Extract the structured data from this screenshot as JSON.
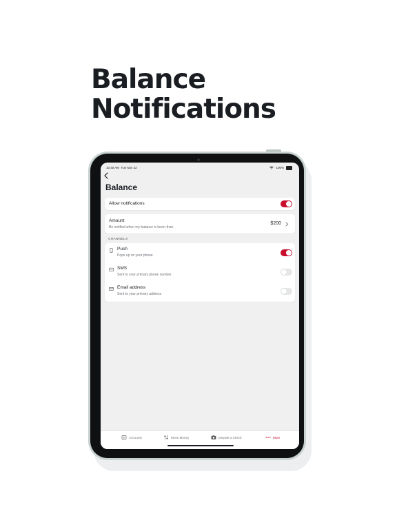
{
  "headline": {
    "line1": "Balance",
    "line2": "Notifications"
  },
  "status_bar": {
    "time": "10:40 AM",
    "date": "Tue Nov 22",
    "battery": "100%"
  },
  "page": {
    "title": "Balance"
  },
  "allow_notifications": {
    "label": "Allow notifications",
    "enabled": true
  },
  "amount": {
    "title": "Amount",
    "subtitle": "Be notified when my balance is lower than",
    "value": "$200"
  },
  "channels": {
    "section_label": "CHANNELS",
    "items": [
      {
        "name": "Push",
        "description": "Pops up on your phone",
        "icon": "phone-icon",
        "enabled": true
      },
      {
        "name": "SMS",
        "description": "Sent to your primary phone number",
        "icon": "message-icon",
        "enabled": false
      },
      {
        "name": "Email address",
        "description": "Sent to your primary address",
        "icon": "envelope-icon",
        "enabled": false
      }
    ]
  },
  "tab_bar": {
    "items": [
      {
        "label": "Accounts",
        "icon": "accounts-icon"
      },
      {
        "label": "Move Money",
        "icon": "transfer-arrows-icon"
      },
      {
        "label": "Deposit a Check",
        "icon": "camera-icon"
      },
      {
        "label": "More",
        "icon": "more-dots-icon",
        "active": true
      }
    ]
  },
  "colors": {
    "accent": "#c8102e",
    "screen_bg": "#f0f0f0",
    "card_bg": "#ffffff",
    "headline": "#1a1d22"
  }
}
